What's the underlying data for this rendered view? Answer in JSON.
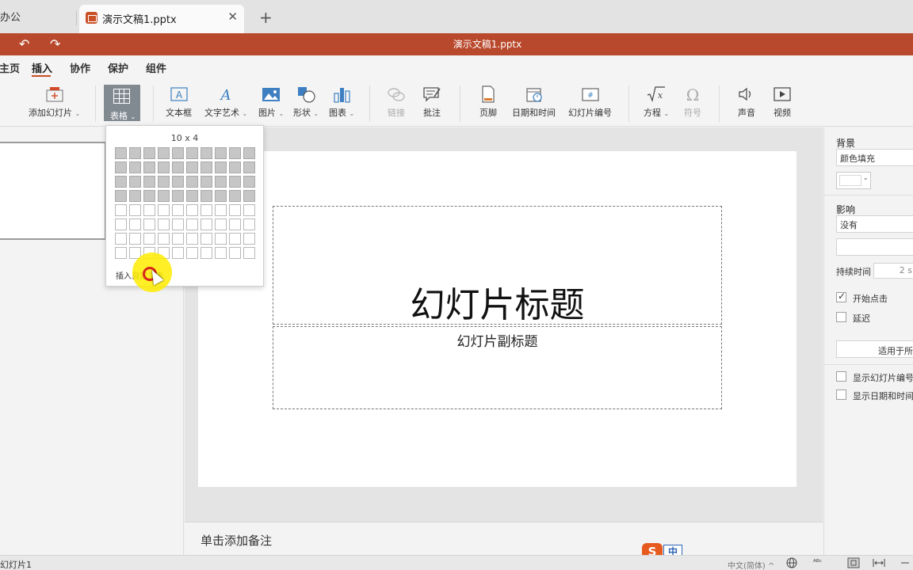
{
  "tabs": {
    "prev_label": "办公",
    "active_label": "演示文稿1.pptx",
    "close_glyph": "✕",
    "add_glyph": "+"
  },
  "titlebar": {
    "title": "演示文稿1.pptx",
    "undo_glyph": "↶",
    "redo_glyph": "↷",
    "color": "#b9492c"
  },
  "menu": {
    "items": [
      "主页",
      "插入",
      "协作",
      "保护",
      "组件"
    ],
    "active": "插入"
  },
  "ribbon": {
    "add_slide": "添加幻灯片",
    "table": "表格",
    "textbox": "文本框",
    "wordart": "文字艺术",
    "picture": "图片",
    "shape": "形状",
    "chart": "图表",
    "link": "链接",
    "comment": "批注",
    "footer": "页脚",
    "datetime": "日期和时间",
    "slide_number": "幻灯片编号",
    "equation": "方程",
    "symbol": "符号",
    "audio": "声音",
    "video": "视频",
    "dropdown_glyph": "⌄"
  },
  "table_dropdown": {
    "size_label": "10 x 4",
    "cols": 10,
    "rows": 8,
    "selected_cols": 10,
    "selected_rows": 4,
    "insert_label": "插入自定义表"
  },
  "slide": {
    "title": "幻灯片标题",
    "subtitle": "幻灯片副标题"
  },
  "notes": {
    "placeholder": "单击添加备注"
  },
  "ime": {
    "logo": "S",
    "mode": "中"
  },
  "right_panel": {
    "background_heading": "背景",
    "fill_type": "颜色填充",
    "effect_heading": "影响",
    "effect_value": "没有",
    "duration_label": "持续时间",
    "duration_value": "2 s",
    "start_on_click": "开始点击",
    "start_on_click_checked": true,
    "delay": "延迟",
    "delay_checked": false,
    "apply_all": "适用于所",
    "show_slide_number": "显示幻灯片编号",
    "show_datetime": "显示日期和时间"
  },
  "statusbar": {
    "slide_label": "幻灯片1",
    "language": "中文(简体) ^",
    "spell_icon": "ᴬᴮᶜ"
  }
}
